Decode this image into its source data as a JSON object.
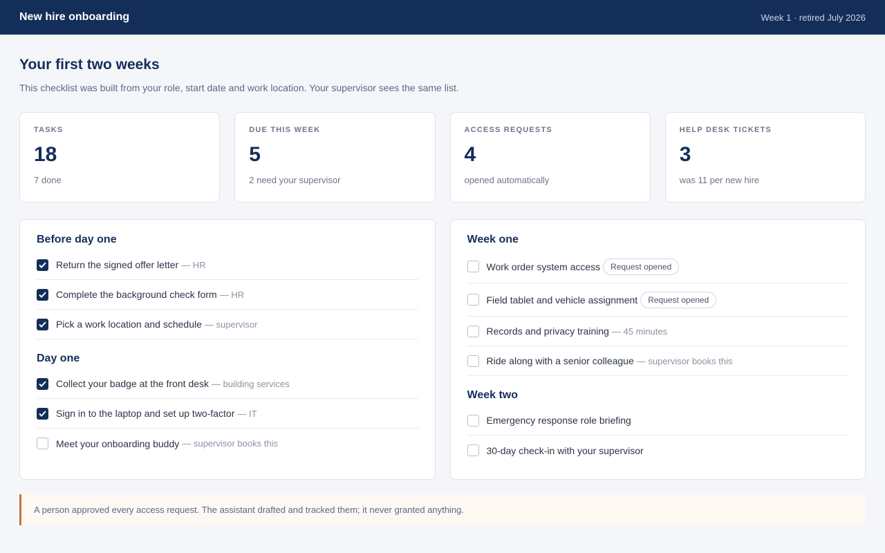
{
  "header": {
    "title": "New hire onboarding",
    "meta": "Week 1 · retired July 2026"
  },
  "page": {
    "title": "Your first two weeks",
    "intro": "This checklist was built from your role, start date and work location. Your supervisor sees the same list."
  },
  "stats": [
    {
      "label": "TASKS",
      "value": "18",
      "sub": "7 done"
    },
    {
      "label": "DUE THIS WEEK",
      "value": "5",
      "sub": "2 need your supervisor"
    },
    {
      "label": "ACCESS REQUESTS",
      "value": "4",
      "sub": "opened automatically"
    },
    {
      "label": "HELP DESK TICKETS",
      "value": "3",
      "sub": "was 11 per new hire"
    }
  ],
  "left": {
    "before": {
      "title": "Before day one",
      "tasks": [
        {
          "label": "Return the signed offer letter",
          "note": "— HR",
          "checked": true
        },
        {
          "label": "Complete the background check form",
          "note": "— HR",
          "checked": true
        },
        {
          "label": "Pick a work location and schedule",
          "note": "— supervisor",
          "checked": true
        }
      ]
    },
    "dayone": {
      "title": "Day one",
      "tasks": [
        {
          "label": "Collect your badge at the front desk",
          "note": "— building services",
          "checked": true
        },
        {
          "label": "Sign in to the laptop and set up two-factor",
          "note": "— IT",
          "checked": true
        },
        {
          "label": "Meet your onboarding buddy",
          "note": "— supervisor books this",
          "checked": false
        }
      ]
    }
  },
  "right": {
    "weekone": {
      "title": "Week one",
      "tasks": [
        {
          "label": "Work order system access",
          "badge": "Request opened",
          "checked": false
        },
        {
          "label": "Field tablet and vehicle assignment",
          "badge": "Request opened",
          "checked": false
        },
        {
          "label": "Records and privacy training",
          "note": "— 45 minutes",
          "checked": false
        },
        {
          "label": "Ride along with a senior colleague",
          "note": "— supervisor books this",
          "checked": false
        }
      ]
    },
    "weektwo": {
      "title": "Week two",
      "tasks": [
        {
          "label": "Emergency response role briefing",
          "checked": false
        },
        {
          "label": "30-day check-in with your supervisor",
          "checked": false
        }
      ]
    }
  },
  "notice": "A person approved every access request. The assistant drafted and tracked them; it never granted anything.",
  "colors": {
    "header_bg": "#142e5a",
    "accent": "#142e5a",
    "notice_border": "#c2773a"
  }
}
